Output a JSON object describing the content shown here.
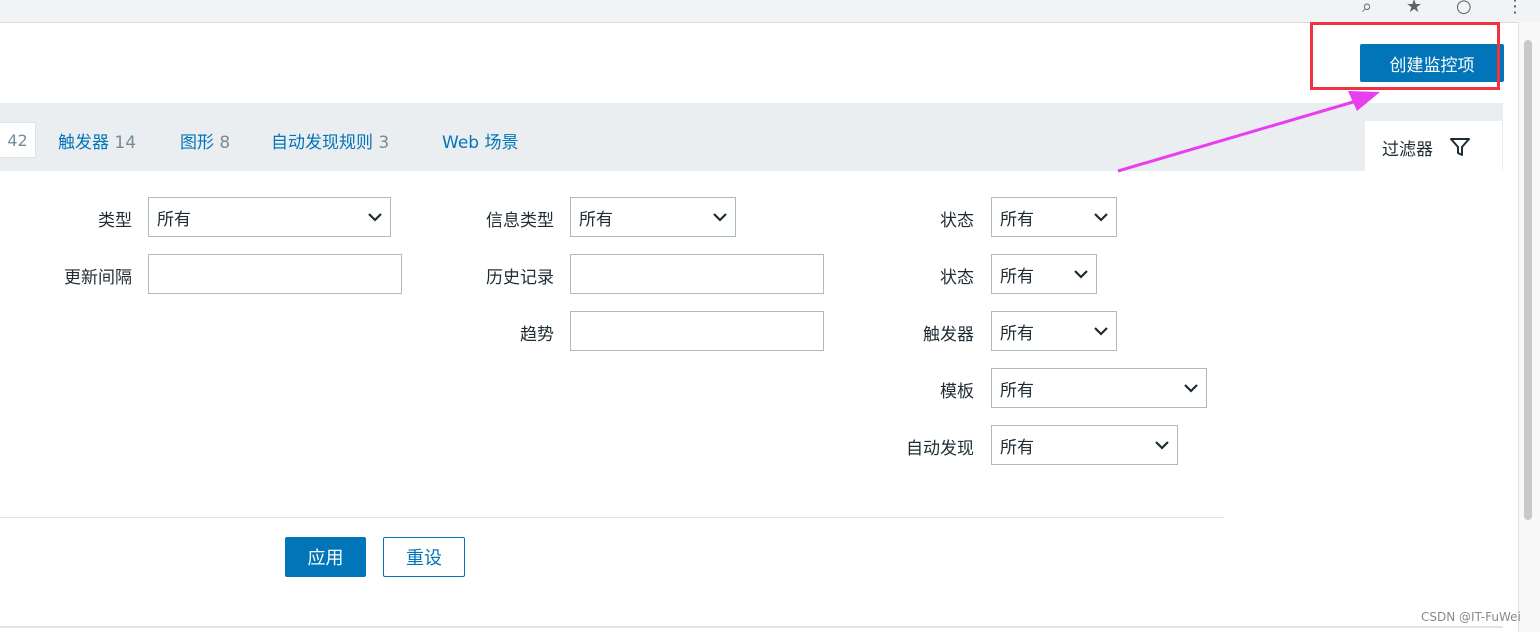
{
  "header": {
    "create_item_label": "创建监控项"
  },
  "tabs": {
    "partial_count": "42",
    "items": [
      {
        "label": "触发器",
        "count": "14"
      },
      {
        "label": "图形",
        "count": "8"
      },
      {
        "label": "自动发现规则",
        "count": "3"
      },
      {
        "label": "Web 场景",
        "count": ""
      }
    ],
    "filter_label": "过滤器"
  },
  "filter": {
    "type": {
      "label": "类型",
      "value": "所有"
    },
    "update_interval": {
      "label": "更新间隔",
      "value": ""
    },
    "info_type": {
      "label": "信息类型",
      "value": "所有"
    },
    "history": {
      "label": "历史记录",
      "value": ""
    },
    "trends": {
      "label": "趋势",
      "value": ""
    },
    "state": {
      "label": "状态",
      "value": "所有"
    },
    "status": {
      "label": "状态",
      "value": "所有"
    },
    "triggers": {
      "label": "触发器",
      "value": "所有"
    },
    "template": {
      "label": "模板",
      "value": "所有"
    },
    "discovery": {
      "label": "自动发现",
      "value": "所有"
    },
    "apply_label": "应用",
    "reset_label": "重设"
  },
  "watermark": "CSDN @IT-FuWei",
  "colors": {
    "accent": "#0275b8",
    "annotation_box": "#ef3340",
    "annotation_arrow": "#e83ef0"
  }
}
